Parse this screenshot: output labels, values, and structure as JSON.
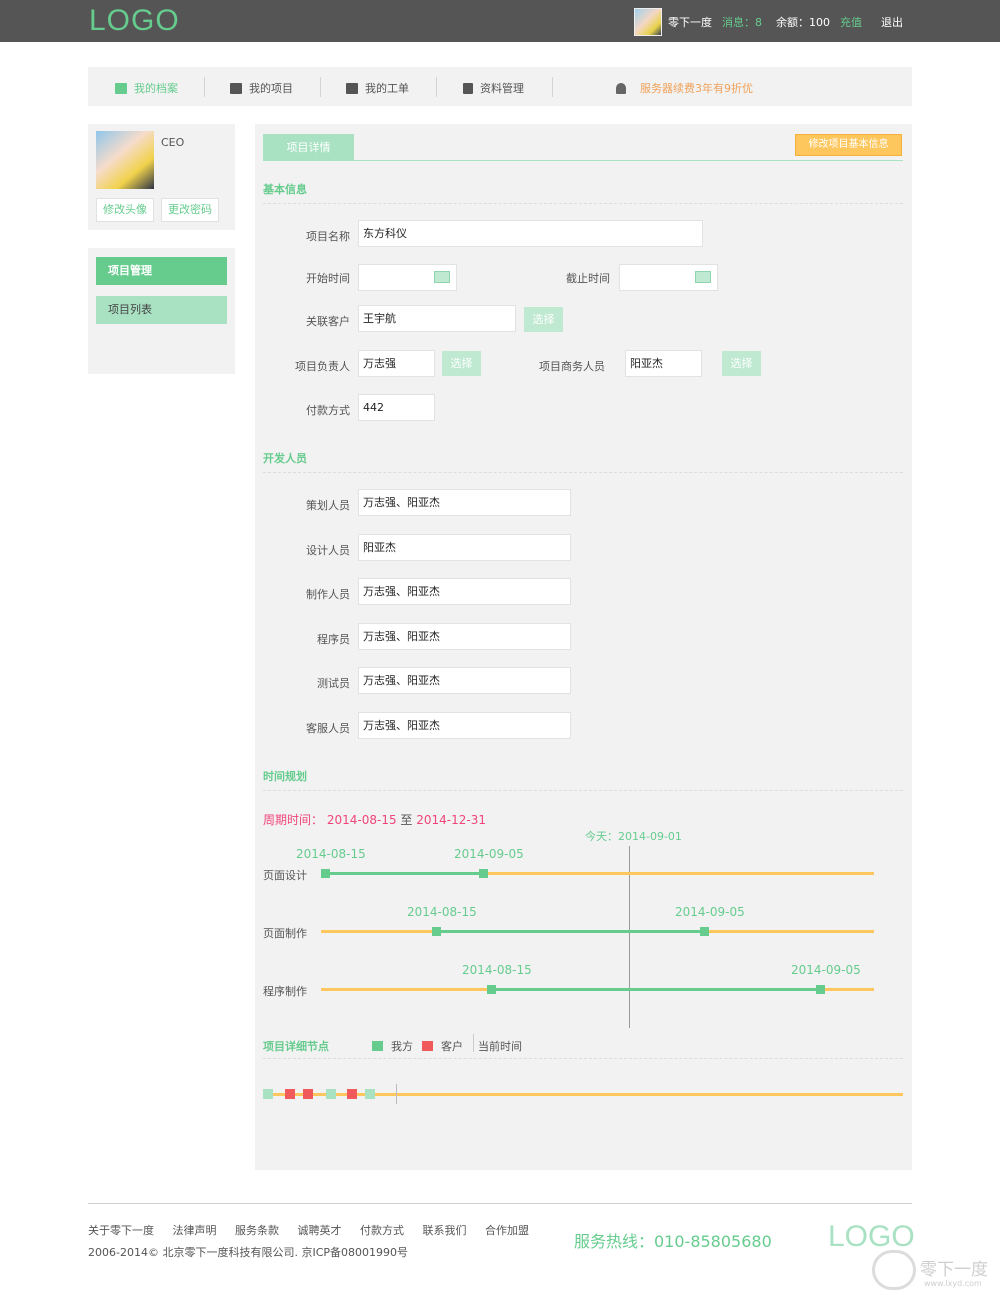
{
  "header": {
    "logo": "LOGO",
    "username": "零下一度",
    "messages": "消息：8",
    "balance": "余额：100",
    "recharge": "充值",
    "logout": "退出"
  },
  "nav": {
    "items": [
      {
        "label": "我的档案",
        "icon": "profile-icon"
      },
      {
        "label": "我的项目",
        "icon": "briefcase-icon"
      },
      {
        "label": "我的工单",
        "icon": "printer-icon"
      },
      {
        "label": "资料管理",
        "icon": "document-icon"
      }
    ],
    "notice": "服务器续费3年有9折优",
    "accent": "#66cc8e",
    "notice_color": "#f0a25a"
  },
  "profile": {
    "role": "CEO",
    "change_avatar": "修改头像",
    "change_password": "更改密码"
  },
  "sidebar": {
    "section": "项目管理",
    "items": [
      "项目列表"
    ]
  },
  "main": {
    "tab": "项目详情",
    "edit_button": "修改项目基本信息",
    "basic": {
      "title": "基本信息",
      "project_name_label": "项目名称",
      "project_name": "东方科仪",
      "start_label": "开始时间",
      "start_value": "",
      "end_label": "截止时间",
      "end_value": "",
      "client_label": "关联客户",
      "client": "王宇航",
      "select": "选择",
      "owner_label": "项目负责人",
      "owner": "万志强",
      "business_label": "项目商务人员",
      "business": "阳亚杰",
      "payment_label": "付款方式",
      "payment": "442"
    },
    "dev": {
      "title": "开发人员",
      "rows": [
        {
          "label": "策划人员",
          "value": "万志强、阳亚杰"
        },
        {
          "label": "设计人员",
          "value": "阳亚杰"
        },
        {
          "label": "制作人员",
          "value": "万志强、阳亚杰"
        },
        {
          "label": "程序员",
          "value": "万志强、阳亚杰"
        },
        {
          "label": "测试员",
          "value": "万志强、阳亚杰"
        },
        {
          "label": "客服人员",
          "value": "万志强、阳亚杰"
        }
      ]
    },
    "schedule": {
      "title": "时间规划",
      "period_label": "周期时间：",
      "period_start": "2014-08-15",
      "period_to": "至",
      "period_end": "2014-12-31",
      "today": "今天：2014-09-01",
      "tasks": [
        {
          "label": "页面设计",
          "start": "2014-08-15",
          "end": "2014-09-05"
        },
        {
          "label": "页面制作",
          "start": "2014-08-15",
          "end": "2014-09-05"
        },
        {
          "label": "程序制作",
          "start": "2014-08-15",
          "end": "2014-09-05"
        }
      ]
    },
    "nodes": {
      "title": "项目详细节点",
      "legend_ours": "我方",
      "legend_client": "客户",
      "legend_now": "当前时间",
      "ours_color": "#66cc8e",
      "client_color": "#f05a5a",
      "sequence": [
        "ours",
        "client",
        "client",
        "ours",
        "client",
        "ours"
      ]
    }
  },
  "footer": {
    "links": [
      "关于零下一度",
      "法律声明",
      "服务条款",
      "诚聘英才",
      "付款方式",
      "联系我们",
      "合作加盟"
    ],
    "copyright": "2006-2014© 北京零下一度科技有限公司.  京ICP备08001990号",
    "hotline": "服务热线：010-85805680",
    "logo": "LOGO",
    "watermark": "零下一度",
    "watermark_url": "www.lxyd.com"
  }
}
